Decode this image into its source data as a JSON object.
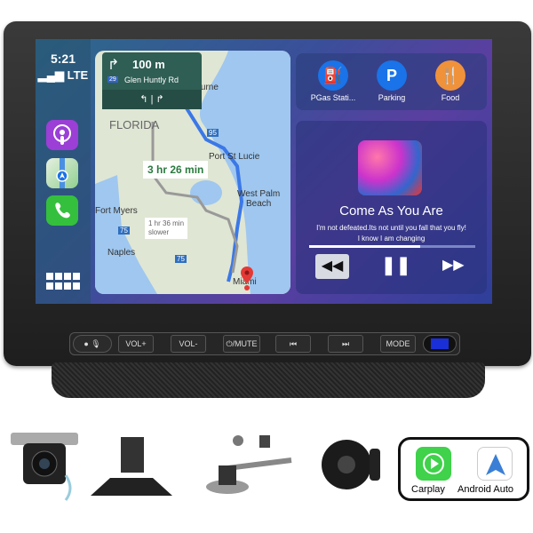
{
  "status": {
    "time": "5:21",
    "network": "LTE"
  },
  "sidebar": {
    "apps": [
      {
        "name": "podcasts",
        "color": "#9b3fd6"
      },
      {
        "name": "maps",
        "color": "#7ac06a"
      },
      {
        "name": "phone",
        "color": "#34c03c"
      }
    ]
  },
  "map": {
    "nav": {
      "distance": "100 m",
      "route_badge": "29",
      "street": "Glen Huntly Rd",
      "lanes": "↰ | ↱"
    },
    "labels": {
      "state": "FLORIDA",
      "melbourne": "elbourne",
      "port_st_lucie": "Port St Lucie",
      "west_palm": "West Palm",
      "beach": "Beach",
      "fort_myers": "Fort Myers",
      "naples": "Naples",
      "miami": "Miami"
    },
    "route_time": "3 hr 26 min",
    "alt_route_time": "1 hr 36 min",
    "alt_route_note": "slower",
    "highways": [
      "95",
      "75",
      "75"
    ]
  },
  "poi": [
    {
      "label": "PGas Stati...",
      "glyph": "⛽",
      "color": "#1a73e8"
    },
    {
      "label": "Parking",
      "glyph": "P",
      "color": "#1a73e8"
    },
    {
      "label": "Food",
      "glyph": "🍴",
      "color": "#f0923a"
    }
  ],
  "music": {
    "title": "Come As You Are",
    "lyric1": "I'm not defeated.Its not until you fall that you fly!",
    "lyric2": "I know I am changing",
    "progress": 0.67
  },
  "hardware_buttons": [
    "VOL+",
    "VOL-",
    "⏻/MUTE",
    "⏮",
    "⏭",
    "MODE"
  ],
  "badge": {
    "carplay": "Carplay",
    "android": "Android Auto"
  }
}
